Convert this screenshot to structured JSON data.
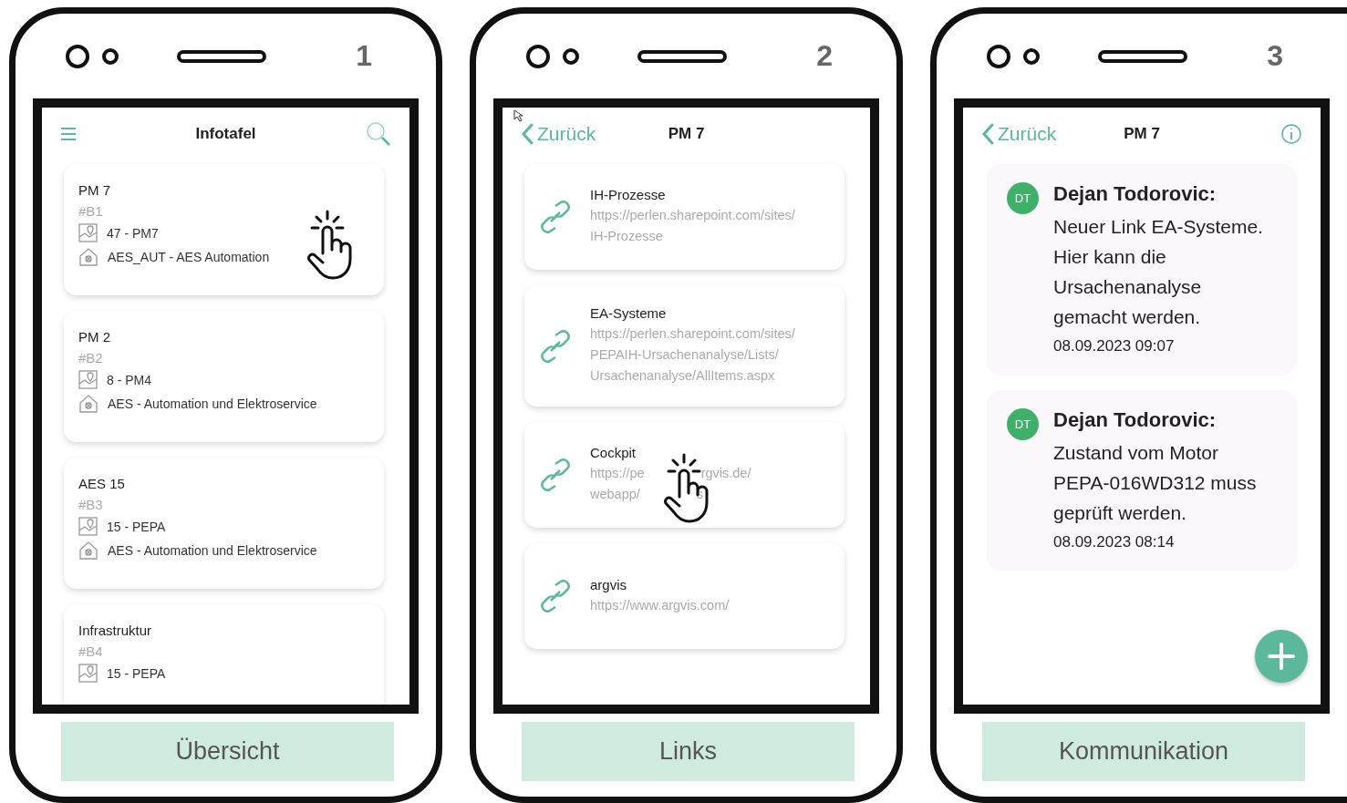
{
  "phones": [
    {
      "number": "1",
      "kind": "overview",
      "header": {
        "title": "Infotafel"
      },
      "cards": [
        {
          "title": "PM 7",
          "code": "#B1",
          "location": "47 - PM7",
          "department": "AES_AUT - AES Automation",
          "hand": true
        },
        {
          "title": "PM 2",
          "code": "#B2",
          "location": "8 - PM4",
          "department": "AES - Automation und Elektroservice",
          "hand": false
        },
        {
          "title": "AES 15",
          "code": "#B3",
          "location": "15 - PEPA",
          "department": "AES - Automation und Elektroservice",
          "hand": false
        },
        {
          "title": "Infrastruktur",
          "code": "#B4",
          "location": "15 - PEPA",
          "hand": false
        }
      ],
      "caption": "Übersicht"
    },
    {
      "number": "2",
      "kind": "links",
      "header": {
        "back": "Zurück",
        "title": "PM 7"
      },
      "links": [
        {
          "title": "IH-Prozesse",
          "url_lines": [
            [
              "https://perlen.sharepoint.com/sites/"
            ],
            [
              "IH-Prozesse"
            ]
          ],
          "hand": false
        },
        {
          "title": "EA-Systeme",
          "url_lines": [
            [
              "https://perlen.sharepoint.com/sites/"
            ],
            [
              "PEPAIH-Ursachenanalyse/Lists/"
            ],
            [
              "Ursachenanalyse/AllItems.aspx"
            ]
          ],
          "hand": false
        },
        {
          "title": "Cockpit",
          "url_lines": [
            [
              "https://pe",
              "rgvis.de/"
            ],
            [
              "webapp/",
              "s"
            ]
          ],
          "hand": true
        },
        {
          "title": "argvis",
          "url_lines": [
            [
              "https://www.argvis.com/"
            ]
          ],
          "hand": false
        }
      ],
      "caption": "Links"
    },
    {
      "number": "3",
      "kind": "chat",
      "header": {
        "back": "Zurück",
        "title": "PM 7"
      },
      "messages": [
        {
          "avatar": "DT",
          "author": "Dejan Todorovic:",
          "text": "Neuer Link EA-Systeme. Hier kann die Ursachenanalyse gemacht werden.",
          "time": "08.09.2023 09:07"
        },
        {
          "avatar": "DT",
          "author": "Dejan Todorovic:",
          "text": "Zustand vom Motor PEPA-016WD312 muss geprüft werden.",
          "time": "08.09.2023 08:14"
        }
      ],
      "caption": "Kommunikation"
    }
  ]
}
